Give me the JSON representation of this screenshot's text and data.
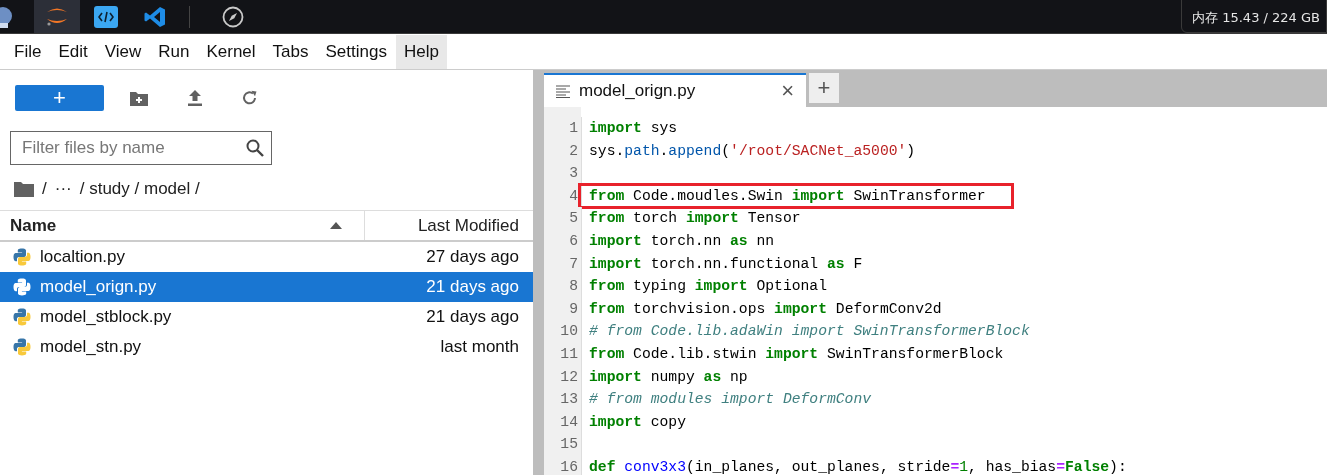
{
  "taskbar": {
    "apps": [
      {
        "kind": "cut",
        "selected": false
      },
      {
        "kind": "jupyter",
        "selected": true
      },
      {
        "kind": "code",
        "selected": false
      },
      {
        "kind": "vscode",
        "selected": false
      },
      {
        "kind": "compass",
        "selected": false
      }
    ],
    "memory": "内存 15.43 / 224 GB"
  },
  "menu": [
    {
      "label": "File",
      "selected": false
    },
    {
      "label": "Edit",
      "selected": false
    },
    {
      "label": "View",
      "selected": false
    },
    {
      "label": "Run",
      "selected": false
    },
    {
      "label": "Kernel",
      "selected": false
    },
    {
      "label": "Tabs",
      "selected": false
    },
    {
      "label": "Settings",
      "selected": false
    },
    {
      "label": "Help",
      "selected": true
    }
  ],
  "file_browser": {
    "new_button": "+",
    "filter": {
      "placeholder": "Filter files by name"
    },
    "breadcrumb": [
      "/",
      "···",
      "/ study / model /"
    ],
    "columns": [
      {
        "label": "Name",
        "sorted": true
      },
      {
        "label": "Last Modified",
        "sorted": false
      }
    ],
    "files": [
      {
        "name": "localtion.py",
        "modified": "27 days ago",
        "selected": false
      },
      {
        "name": "model_orign.py",
        "modified": "21 days ago",
        "selected": true
      },
      {
        "name": "model_stblock.py",
        "modified": "21 days ago",
        "selected": false
      },
      {
        "name": "model_stn.py",
        "modified": "last month",
        "selected": false
      }
    ]
  },
  "editor": {
    "tabs": [
      {
        "title": "model_orign.py",
        "close": "×",
        "selected": true
      }
    ],
    "add_tab": "+",
    "lines": [
      {
        "number": "1",
        "highlighted": false,
        "tokens": [
          {
            "kind": "kw",
            "text": "import"
          },
          {
            "kind": "p",
            "text": " sys"
          }
        ]
      },
      {
        "number": "2",
        "highlighted": false,
        "tokens": [
          {
            "kind": "p",
            "text": "sys."
          },
          {
            "kind": "prop",
            "text": "path"
          },
          {
            "kind": "p",
            "text": "."
          },
          {
            "kind": "prop",
            "text": "append"
          },
          {
            "kind": "p",
            "text": "("
          },
          {
            "kind": "str",
            "text": "'/root/SACNet_a5000'"
          },
          {
            "kind": "p",
            "text": ")"
          }
        ]
      },
      {
        "number": "3",
        "highlighted": false
      },
      {
        "number": "4",
        "highlighted": true,
        "tokens": [
          {
            "kind": "kw",
            "text": "from"
          },
          {
            "kind": "p",
            "text": " Code.moudles.Swin "
          },
          {
            "kind": "kw",
            "text": "import"
          },
          {
            "kind": "p",
            "text": " SwinTransformer"
          }
        ]
      },
      {
        "number": "5",
        "highlighted": false,
        "tokens": [
          {
            "kind": "kw",
            "text": "from"
          },
          {
            "kind": "p",
            "text": " torch "
          },
          {
            "kind": "kw",
            "text": "import"
          },
          {
            "kind": "p",
            "text": " Tensor"
          }
        ]
      },
      {
        "number": "6",
        "highlighted": false,
        "tokens": [
          {
            "kind": "kw",
            "text": "import"
          },
          {
            "kind": "p",
            "text": " torch.nn "
          },
          {
            "kind": "kw",
            "text": "as"
          },
          {
            "kind": "p",
            "text": " nn"
          }
        ]
      },
      {
        "number": "7",
        "highlighted": false,
        "tokens": [
          {
            "kind": "kw",
            "text": "import"
          },
          {
            "kind": "p",
            "text": " torch.nn.functional "
          },
          {
            "kind": "kw",
            "text": "as"
          },
          {
            "kind": "p",
            "text": " F"
          }
        ]
      },
      {
        "number": "8",
        "highlighted": false,
        "tokens": [
          {
            "kind": "kw",
            "text": "from"
          },
          {
            "kind": "p",
            "text": " typing "
          },
          {
            "kind": "kw",
            "text": "import"
          },
          {
            "kind": "p",
            "text": " Optional"
          }
        ]
      },
      {
        "number": "9",
        "highlighted": false,
        "tokens": [
          {
            "kind": "kw",
            "text": "from"
          },
          {
            "kind": "p",
            "text": " torchvision.ops "
          },
          {
            "kind": "kw",
            "text": "import"
          },
          {
            "kind": "p",
            "text": " DeformConv2d"
          }
        ]
      },
      {
        "number": "10",
        "highlighted": false,
        "tokens": [
          {
            "kind": "comment",
            "text": "# from Code.lib.adaWin import SwinTransformerBlock"
          }
        ]
      },
      {
        "number": "11",
        "highlighted": false,
        "tokens": [
          {
            "kind": "kw",
            "text": "from"
          },
          {
            "kind": "p",
            "text": " Code.lib.stwin "
          },
          {
            "kind": "kw",
            "text": "import"
          },
          {
            "kind": "p",
            "text": " SwinTransformerBlock"
          }
        ]
      },
      {
        "number": "12",
        "highlighted": false,
        "tokens": [
          {
            "kind": "kw",
            "text": "import"
          },
          {
            "kind": "p",
            "text": " numpy "
          },
          {
            "kind": "kw",
            "text": "as"
          },
          {
            "kind": "p",
            "text": " np"
          }
        ]
      },
      {
        "number": "13",
        "highlighted": false,
        "tokens": [
          {
            "kind": "comment",
            "text": "# from modules import DeformConv"
          }
        ]
      },
      {
        "number": "14",
        "highlighted": false,
        "tokens": [
          {
            "kind": "kw",
            "text": "import"
          },
          {
            "kind": "p",
            "text": " copy"
          }
        ]
      },
      {
        "number": "15",
        "highlighted": false
      },
      {
        "number": "16",
        "highlighted": false,
        "tokens": [
          {
            "kind": "kw",
            "text": "def"
          },
          {
            "kind": "def",
            "text": " conv3x3"
          },
          {
            "kind": "p",
            "text": "(in_planes, out_planes, stride"
          },
          {
            "kind": "op",
            "text": "="
          },
          {
            "kind": "num",
            "text": "1"
          },
          {
            "kind": "p",
            "text": ", has_bias"
          },
          {
            "kind": "op",
            "text": "="
          },
          {
            "kind": "kw",
            "text": "False"
          },
          {
            "kind": "p",
            "text": "):"
          }
        ]
      }
    ]
  }
}
